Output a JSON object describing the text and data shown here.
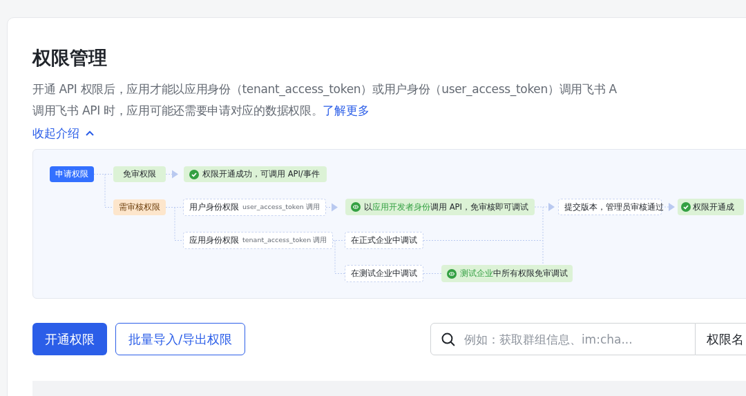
{
  "title": "权限管理",
  "description": {
    "lines": [
      "开通 API 权限后，应用才能以应用身份（tenant_access_token）或用户身份（user_access_token）调用飞书 A",
      "调用飞书 API 时，应用可能还需要申请对应的数据权限。"
    ],
    "link": "了解更多"
  },
  "collapse_link": {
    "label": "收起介绍",
    "expanded": true
  },
  "diagram": {
    "nodes": [
      {
        "kind": "primary",
        "text": "申请权限"
      },
      {
        "kind": "success",
        "text": "免审权限"
      },
      {
        "kind": "done",
        "text": "权限开通成功，可调用 API/事件"
      },
      {
        "kind": "warning",
        "text": "需审核权限"
      },
      {
        "kind": "plain",
        "text": "用户身份权限",
        "note": "user_access_token 调用"
      },
      {
        "kind": "debug",
        "prefix": "以",
        "highlight": "应用开发者身份",
        "suffix": "调用 API，免审核即可调试"
      },
      {
        "kind": "plain",
        "text": "提交版本，管理员审核通过"
      },
      {
        "kind": "done",
        "text": "权限开通成"
      },
      {
        "kind": "plain",
        "text": "应用身份权限",
        "note": "tenant_access_token 调用"
      },
      {
        "kind": "plain",
        "text": "在正式企业中调试"
      },
      {
        "kind": "plain",
        "text": "在测试企业中调试"
      },
      {
        "kind": "debug",
        "highlight": "测试企业",
        "suffix": "中所有权限免审调试"
      }
    ]
  },
  "buttons": [
    {
      "label": "开通权限",
      "kind": "primary"
    },
    {
      "label": "批量导入/导出权限",
      "kind": "outline"
    }
  ],
  "search": {
    "placeholder": "例如：获取群组信息、im:cha..."
  },
  "filter_select": {
    "value": "权限名"
  }
}
